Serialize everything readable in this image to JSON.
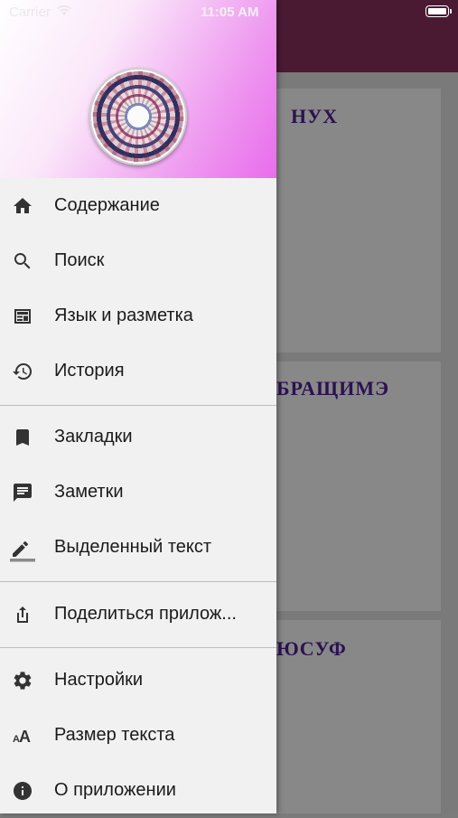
{
  "status_bar": {
    "carrier": "Carrier",
    "time": "11:05 AM"
  },
  "background": {
    "cards": [
      "НУХ",
      "БРАЩИМЭ",
      "ЮСУФ"
    ]
  },
  "drawer": {
    "groups": [
      [
        {
          "label": "Содержание",
          "icon": "home-icon"
        },
        {
          "label": "Поиск",
          "icon": "search-icon"
        },
        {
          "label": "Язык и разметка",
          "icon": "layout-icon"
        },
        {
          "label": "История",
          "icon": "history-icon"
        }
      ],
      [
        {
          "label": "Закладки",
          "icon": "bookmark-icon"
        },
        {
          "label": "Заметки",
          "icon": "note-icon"
        },
        {
          "label": "Выделенный текст",
          "icon": "highlight-pen-icon"
        }
      ],
      [
        {
          "label": "Поделиться прилож...",
          "icon": "share-icon"
        }
      ],
      [
        {
          "label": "Настройки",
          "icon": "gear-icon"
        },
        {
          "label": "Размер текста",
          "icon": "text-size-icon"
        },
        {
          "label": "О приложении",
          "icon": "info-icon"
        }
      ]
    ]
  }
}
